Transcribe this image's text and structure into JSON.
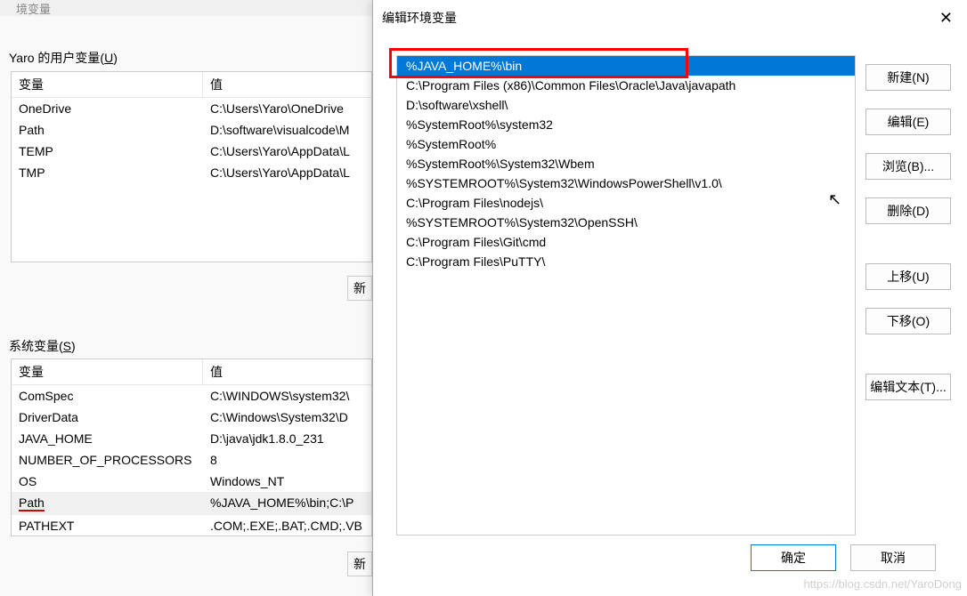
{
  "bg": {
    "header_hint": "境变量",
    "user_vars_label_prefix": "Yaro 的用户变量(",
    "user_vars_label_key": "U",
    "user_vars_label_suffix": ")",
    "sys_vars_label_prefix": "系统变量(",
    "sys_vars_label_key": "S",
    "sys_vars_label_suffix": ")",
    "col_var": "变量",
    "col_val": "值",
    "new_btn": "新",
    "user_rows": [
      {
        "var": "OneDrive",
        "val": "C:\\Users\\Yaro\\OneDrive"
      },
      {
        "var": "Path",
        "val": "D:\\software\\visualcode\\M"
      },
      {
        "var": "TEMP",
        "val": "C:\\Users\\Yaro\\AppData\\L"
      },
      {
        "var": "TMP",
        "val": "C:\\Users\\Yaro\\AppData\\L"
      }
    ],
    "sys_rows": [
      {
        "var": "ComSpec",
        "val": "C:\\WINDOWS\\system32\\"
      },
      {
        "var": "DriverData",
        "val": "C:\\Windows\\System32\\D"
      },
      {
        "var": "JAVA_HOME",
        "val": "D:\\java\\jdk1.8.0_231"
      },
      {
        "var": "NUMBER_OF_PROCESSORS",
        "val": "8"
      },
      {
        "var": "OS",
        "val": "Windows_NT"
      },
      {
        "var": "Path",
        "val": "%JAVA_HOME%\\bin;C:\\P",
        "highlight": true
      },
      {
        "var": "PATHEXT",
        "val": ".COM;.EXE;.BAT;.CMD;.VB"
      }
    ]
  },
  "dialog": {
    "title": "编辑环境变量",
    "close": "✕",
    "items": [
      "%JAVA_HOME%\\bin",
      "C:\\Program Files (x86)\\Common Files\\Oracle\\Java\\javapath",
      "D:\\software\\xshell\\",
      "%SystemRoot%\\system32",
      "%SystemRoot%",
      "%SystemRoot%\\System32\\Wbem",
      "%SYSTEMROOT%\\System32\\WindowsPowerShell\\v1.0\\",
      "C:\\Program Files\\nodejs\\",
      "%SYSTEMROOT%\\System32\\OpenSSH\\",
      "C:\\Program Files\\Git\\cmd",
      "C:\\Program Files\\PuTTY\\"
    ],
    "selected_index": 0,
    "buttons": {
      "new": "新建(N)",
      "edit": "编辑(E)",
      "browse": "浏览(B)...",
      "delete": "删除(D)",
      "up": "上移(U)",
      "down": "下移(O)",
      "edit_text": "编辑文本(T)...",
      "ok": "确定",
      "cancel": "取消"
    }
  },
  "watermark": "https://blog.csdn.net/YaroDong"
}
